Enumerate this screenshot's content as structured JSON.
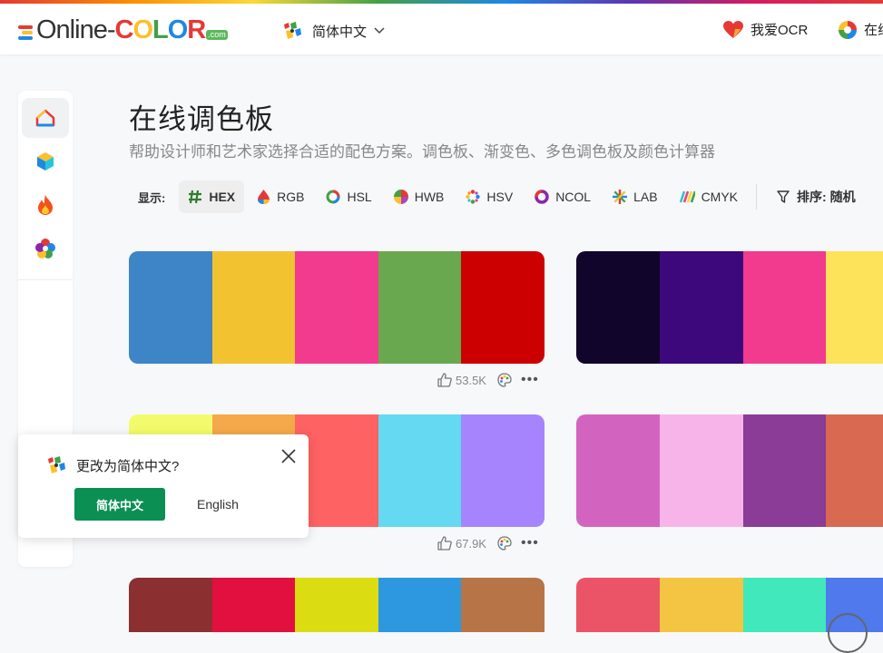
{
  "brand": {
    "logo_main": "Online-",
    "logo_letters": [
      "C",
      "O",
      "L",
      "O",
      "R"
    ],
    "logo_letter_colors": [
      "#e53935",
      "#fbc02d",
      "#43a047",
      "#1e88e5",
      "#e53935"
    ],
    "logo_suffix": ".com"
  },
  "header": {
    "language_label": "简体中文",
    "links": [
      {
        "label": "我爱OCR",
        "icon": "heart-icon"
      },
      {
        "label": "在线",
        "icon": "color-wheel-icon"
      }
    ]
  },
  "sidebar": {
    "items": [
      {
        "icon": "home-icon",
        "active": true
      },
      {
        "icon": "cube-icon",
        "active": false
      },
      {
        "icon": "fire-icon",
        "active": false
      },
      {
        "icon": "palette-flower-icon",
        "active": false
      }
    ]
  },
  "page": {
    "title": "在线调色板",
    "subtitle": "帮助设计师和艺术家选择合适的配色方案。调色板、渐变色、多色调色板及颜色计算器"
  },
  "filters": {
    "label": "显示:",
    "formats": [
      {
        "label": "HEX",
        "active": true
      },
      {
        "label": "RGB",
        "active": false
      },
      {
        "label": "HSL",
        "active": false
      },
      {
        "label": "HWB",
        "active": false
      },
      {
        "label": "HSV",
        "active": false
      },
      {
        "label": "NCOL",
        "active": false
      },
      {
        "label": "LAB",
        "active": false
      },
      {
        "label": "CMYK",
        "active": false
      }
    ],
    "sort_label": "排序: 随机"
  },
  "palettes": [
    {
      "colors": [
        "#3d85c6",
        "#f2c230",
        "#f23a8f",
        "#6aa84f",
        "#cc0000"
      ],
      "likes": "53.5K"
    },
    {
      "colors": [
        "#12052b",
        "#3c087b",
        "#f23a8f",
        "#fde35a"
      ],
      "likes": ""
    },
    {
      "colors": [
        "#f2fb6c",
        "#f5a94a",
        "#ff6262",
        "#64d9f1",
        "#a684fd"
      ],
      "likes": "67.9K"
    },
    {
      "colors": [
        "#d264c0",
        "#f7b4e9",
        "#8a3c97",
        "#d96950"
      ],
      "likes": ""
    },
    {
      "colors": [
        "#8b2f31",
        "#e1103e",
        "#dcdc13",
        "#2d98e0",
        "#b77446"
      ],
      "likes": ""
    },
    {
      "colors": [
        "#eb5466",
        "#f4c542",
        "#40e8bb",
        "#4f79ec"
      ],
      "likes": ""
    }
  ],
  "popup": {
    "question": "更改为简体中文?",
    "primary_label": "简体中文",
    "secondary_label": "English"
  }
}
